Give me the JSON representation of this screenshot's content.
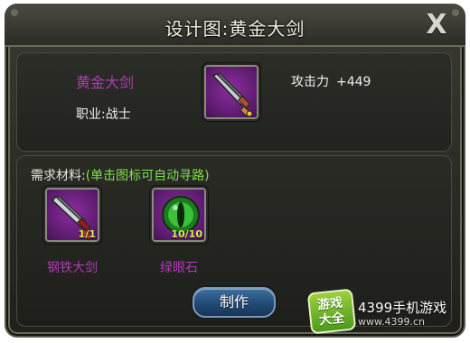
{
  "dialog": {
    "title": "设计图:黄金大剑",
    "close_label": "X"
  },
  "item": {
    "name": "黄金大剑",
    "job": "职业:战士",
    "attack_label": "攻击力",
    "attack_value": "+449",
    "icon": "golden-greatsword-icon"
  },
  "requirements": {
    "title": "需求材料:",
    "hint": "(单击图标可自动寻路)",
    "materials": [
      {
        "name": "钢铁大剑",
        "count": "1/1",
        "icon": "steel-greatsword-icon"
      },
      {
        "name": "绿眼石",
        "count": "10/10",
        "icon": "green-eye-stone-icon"
      }
    ]
  },
  "actions": {
    "make_label": "制作"
  },
  "watermark": {
    "logo_line1": "游戏",
    "logo_line2": "大全",
    "site": "4399手机游戏",
    "url": "www.4399.cn"
  },
  "colors": {
    "item_name": "#b03ab8",
    "hint_green": "#7fe04a",
    "count_yellow": "#d7f04a",
    "button_blue": "#214a77"
  }
}
